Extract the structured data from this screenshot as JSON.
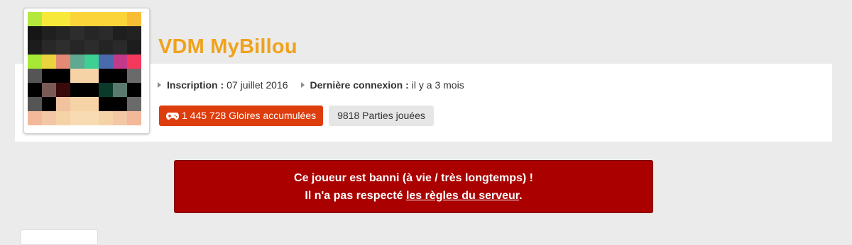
{
  "profile": {
    "username": "VDM MyBillou",
    "inscription_label": "Inscription :",
    "inscription_value": "07 juillet 2016",
    "last_login_label": "Dernière connexion :",
    "last_login_value": "il y a 3 mois",
    "glory_badge": "1 445 728 Gloires accumulées",
    "games_badge": "9818 Parties jouées"
  },
  "ban": {
    "line1": "Ce joueur est banni (à vie / très longtemps) !",
    "line2_prefix": "Il n'a pas respecté ",
    "rules_link": "les règles du serveur",
    "line2_suffix": "."
  },
  "colors": {
    "username": "#f0a21a",
    "glory_badge": "#dd3d0c",
    "ban_background": "#aa0000"
  },
  "icons": {
    "info_bullet": "triangle-right-icon",
    "glory": "gamepad-icon"
  }
}
